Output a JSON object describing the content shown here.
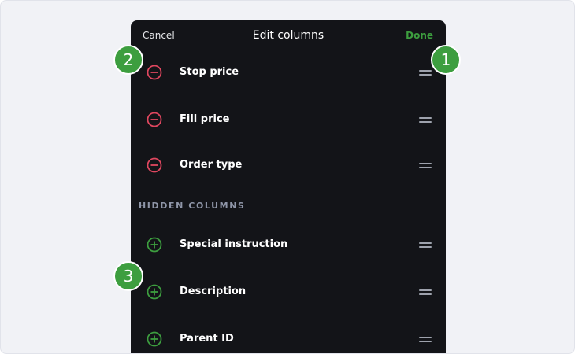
{
  "header": {
    "cancel_label": "Cancel",
    "title": "Edit columns",
    "done_label": "Done"
  },
  "visible_columns": [
    {
      "label": "Stop price",
      "action_icon": "remove-circle-icon"
    },
    {
      "label": "Fill price",
      "action_icon": "remove-circle-icon"
    },
    {
      "label": "Order type",
      "action_icon": "remove-circle-icon"
    }
  ],
  "hidden_section_title": "HIDDEN COLUMNS",
  "hidden_columns": [
    {
      "label": "Special instruction",
      "action_icon": "add-circle-icon"
    },
    {
      "label": "Description",
      "action_icon": "add-circle-icon"
    },
    {
      "label": "Parent ID",
      "action_icon": "add-circle-icon"
    }
  ],
  "callouts": [
    "1",
    "2",
    "3"
  ],
  "colors": {
    "background": "#f1f2f6",
    "panel": "#131418",
    "accent_green": "#3d9e3f",
    "remove_red": "#e0475f",
    "drag_handle": "#9ea2ad",
    "section_title": "#8f96a8"
  }
}
